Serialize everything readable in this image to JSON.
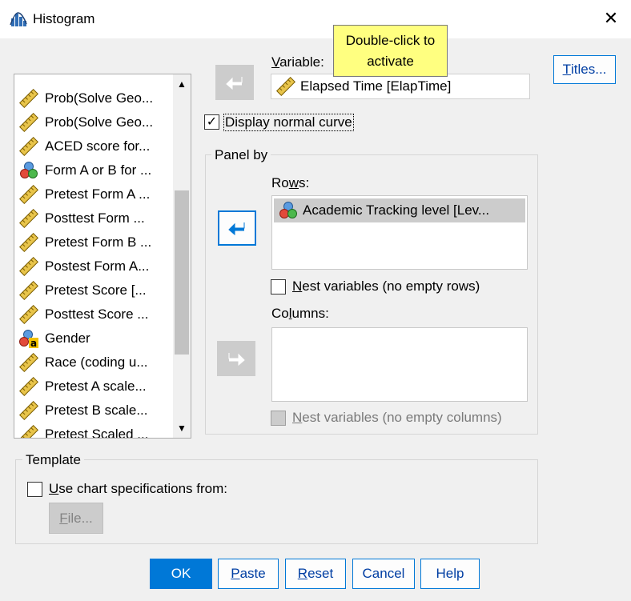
{
  "window": {
    "title": "Histogram",
    "close_glyph": "✕"
  },
  "variable_list": {
    "items": [
      {
        "label": "Prob(Solve Geo...",
        "icon": "ruler-icon"
      },
      {
        "label": "Prob(Solve Geo...",
        "icon": "ruler-icon"
      },
      {
        "label": "ACED score for...",
        "icon": "ruler-icon"
      },
      {
        "label": "Form A or B for ...",
        "icon": "nominal-icon"
      },
      {
        "label": "Pretest Form A ...",
        "icon": "ruler-icon"
      },
      {
        "label": "Posttest Form ...",
        "icon": "ruler-icon"
      },
      {
        "label": "Pretest Form B ...",
        "icon": "ruler-icon"
      },
      {
        "label": "Postest Form A...",
        "icon": "ruler-icon"
      },
      {
        "label": "Pretest Score [...",
        "icon": "ruler-icon"
      },
      {
        "label": "Posttest Score ...",
        "icon": "ruler-icon"
      },
      {
        "label": "Gender",
        "icon": "nominal-string-icon"
      },
      {
        "label": "Race (coding u...",
        "icon": "ruler-icon"
      },
      {
        "label": "Pretest A scale...",
        "icon": "ruler-icon"
      },
      {
        "label": "Pretest B scale...",
        "icon": "ruler-icon"
      },
      {
        "label": "Pretest Scaled ...",
        "icon": "ruler-icon"
      }
    ],
    "scroll_up_glyph": "▲",
    "scroll_down_glyph": "▼"
  },
  "variable": {
    "label_first": "V",
    "label_rest": "ariable:",
    "value": "Elapsed Time [ElapTime]"
  },
  "tooltip": {
    "line1": "Double-click to",
    "line2": "activate"
  },
  "titles_button": {
    "first": "T",
    "rest": "itles..."
  },
  "display_normal_curve": {
    "label": "Display normal curve",
    "checked_glyph": "✓"
  },
  "panel_by": {
    "legend": "Panel by",
    "rows_label_first": "Ro",
    "rows_label_u": "w",
    "rows_label_rest": "s:",
    "rows_value": "Academic Tracking level [Lev...",
    "nest_rows_first": "N",
    "nest_rows_rest": "est variables (no empty rows)",
    "columns_label_first": "Co",
    "columns_label_u": "l",
    "columns_label_rest": "umns:",
    "nest_cols_first": "N",
    "nest_cols_rest": "est variables (no empty columns)"
  },
  "template": {
    "legend": "Template",
    "use_spec_first": "U",
    "use_spec_rest": "se chart specifications from:",
    "file_first": "F",
    "file_rest": "ile..."
  },
  "buttons": {
    "ok": "OK",
    "paste_first": "P",
    "paste_rest": "aste",
    "reset_first": "R",
    "reset_rest": "eset",
    "cancel": "Cancel",
    "help": "Help"
  },
  "colors": {
    "accent": "#0078d7",
    "tooltip_bg": "#ffff80",
    "selection_bg": "#cccccc"
  }
}
